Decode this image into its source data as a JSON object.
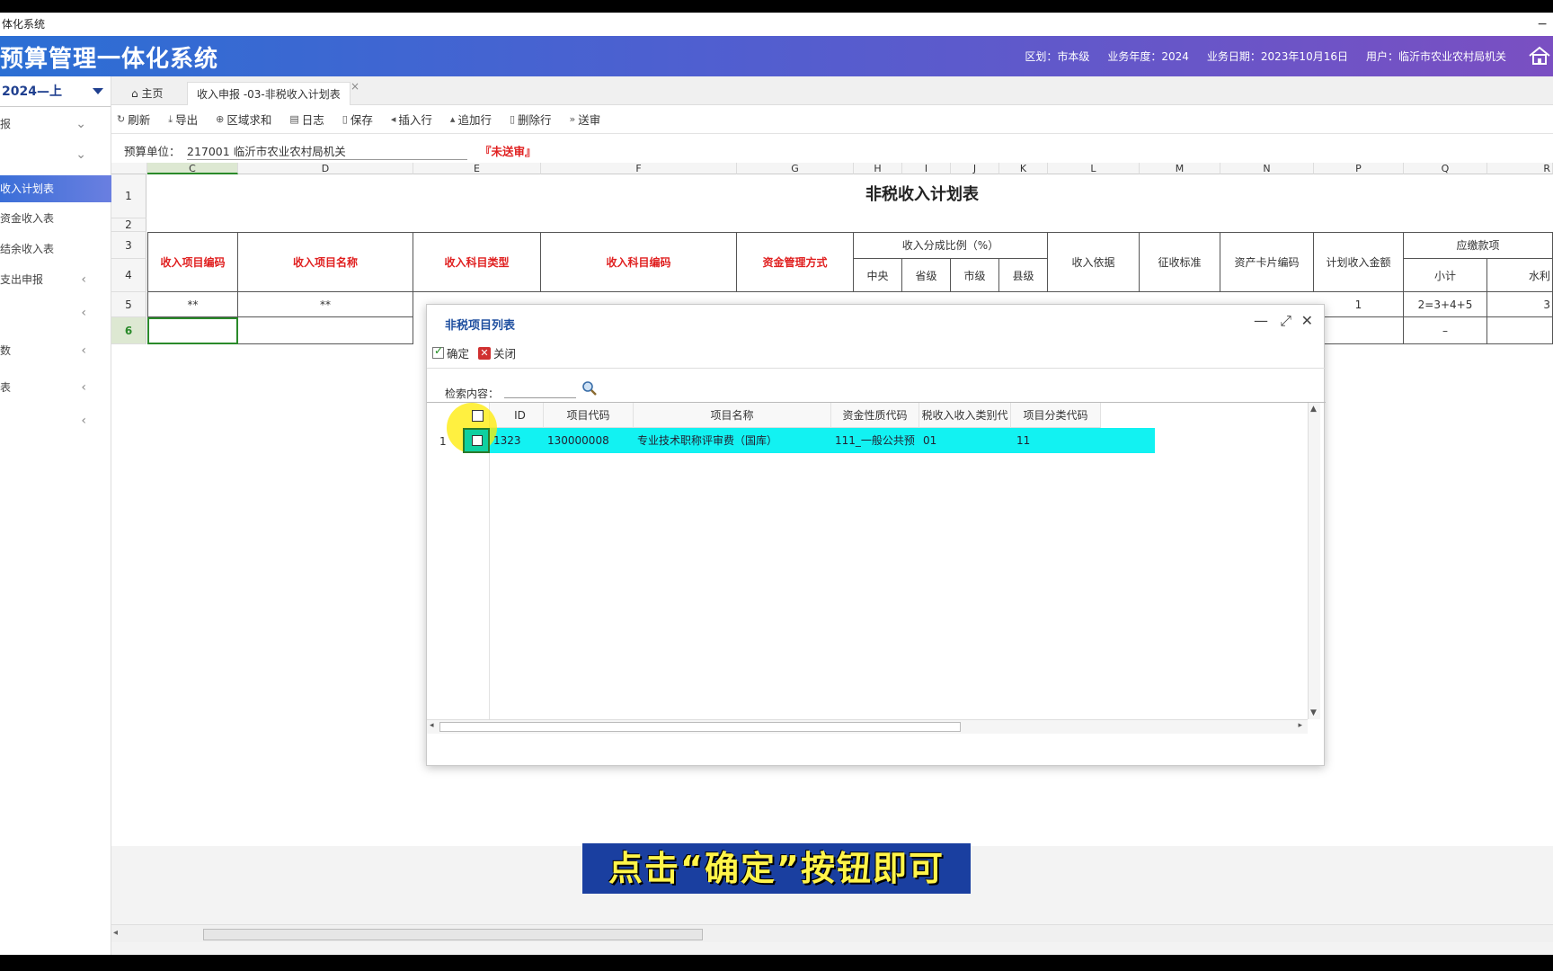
{
  "window": {
    "title": "体化系统",
    "minimize_glyph": "−"
  },
  "header": {
    "app_title": "预算管理一体化系统",
    "region": "区划：市本级",
    "year": "业务年度：2024",
    "date": "业务日期：2023年10月16日",
    "user": "用户：临沂市农业农村局机关",
    "home_icon": "home-icon"
  },
  "sidebar": {
    "year_select": "2024—上",
    "items": [
      {
        "label": "报",
        "arrow": "⌄"
      },
      {
        "label": "",
        "arrow": "⌄"
      },
      {
        "label": "收入计划表",
        "arrow": "",
        "active": true
      },
      {
        "label": "资金收入表",
        "arrow": ""
      },
      {
        "label": "结余收入表",
        "arrow": ""
      },
      {
        "label": "支出申报",
        "arrow": "‹"
      },
      {
        "label": "",
        "arrow": "‹"
      },
      {
        "label": "数",
        "arrow": "‹"
      },
      {
        "label": "表",
        "arrow": "‹"
      },
      {
        "label": "",
        "arrow": "‹"
      }
    ]
  },
  "tabs": {
    "home": "主页",
    "active": "收入申报 -03-非税收入计划表",
    "close": "×"
  },
  "toolbar": {
    "refresh": "刷新",
    "export": "导出",
    "region_sum": "区域求和",
    "log": "日志",
    "save": "保存",
    "insert_row": "插入行",
    "append_row": "追加行",
    "delete_row": "删除行",
    "submit": "送审"
  },
  "unit": {
    "label": "预算单位：",
    "value": "217001  临沂市农业农村局机关",
    "status": "『未送审』"
  },
  "sheet": {
    "columns": [
      "C",
      "D",
      "E",
      "F",
      "G",
      "H",
      "I",
      "J",
      "K",
      "L",
      "M",
      "N",
      "P",
      "Q",
      "R"
    ],
    "rows": [
      "1",
      "2",
      "3",
      "4",
      "5",
      "6"
    ],
    "title": "非税收入计划表",
    "headers": {
      "item_code": "收入项目编码",
      "item_name": "收入项目名称",
      "subject_type": "收入科目类型",
      "subject_code": "收入科目编码",
      "fund_mgmt": "资金管理方式",
      "share_ratio": "收入分成比例（%）",
      "central": "中央",
      "province": "省级",
      "city": "市级",
      "county": "县级",
      "basis": "收入依据",
      "standard": "征收标准",
      "asset_card": "资产卡片编码",
      "plan_amount": "计划收入金额",
      "payable": "应缴款项",
      "subtotal": "小计",
      "water": "水利"
    },
    "row5": {
      "c": "**",
      "d": "**",
      "p": "1",
      "q": "2=3+4+5",
      "r": "3"
    },
    "row6": {
      "q": "–"
    }
  },
  "dialog": {
    "title": "非税项目列表",
    "confirm": "确定",
    "close": "关闭",
    "search_label": "检索内容：",
    "search_value": "",
    "columns": {
      "id": "ID",
      "code": "项目代码",
      "name": "项目名称",
      "fund_nature": "资金性质代码",
      "income_type": "税收入收入类别代",
      "category": "项目分类代码"
    },
    "rows": [
      {
        "num": "1",
        "id": "1323",
        "code": "130000008",
        "name": "专业技术职称评审费（国库）",
        "fund_nature": "111_一般公共预",
        "income_type": "01",
        "category": "11"
      }
    ]
  },
  "caption": "点击“确定”按钮即可",
  "colors": {
    "header_start": "#2b6fd4",
    "header_end": "#7a4fc2",
    "accent_red": "#e02020",
    "row_highlight": "#12f2f2"
  }
}
